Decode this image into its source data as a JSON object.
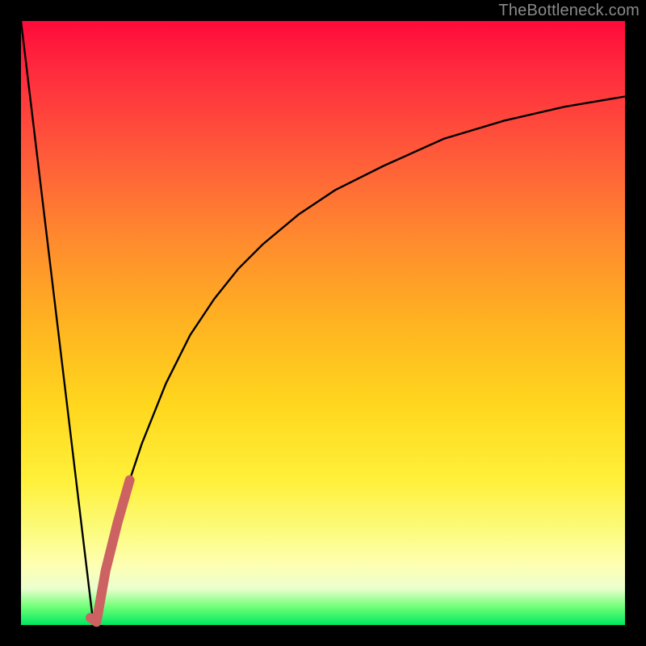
{
  "watermark": {
    "text": "TheBottleneck.com"
  },
  "colors": {
    "background": "#000000",
    "curve_stroke": "#000000",
    "highlight_stroke": "#cc6262"
  },
  "chart_data": {
    "type": "line",
    "title": "",
    "xlabel": "",
    "ylabel": "",
    "xlim": [
      0,
      100
    ],
    "ylim": [
      0,
      100
    ],
    "grid": false,
    "legend": false,
    "series": [
      {
        "name": "left-linear-drop",
        "x": [
          0,
          12
        ],
        "y": [
          100,
          0
        ]
      },
      {
        "name": "saturating-curve",
        "x": [
          12,
          14,
          16,
          18,
          20,
          24,
          28,
          32,
          36,
          40,
          46,
          52,
          60,
          70,
          80,
          90,
          100
        ],
        "y": [
          0,
          9,
          17,
          24,
          30,
          40,
          48,
          54,
          59,
          63,
          68,
          72,
          76,
          80.5,
          83.5,
          85.8,
          87.5
        ]
      },
      {
        "name": "highlight-j-segment",
        "x": [
          11.5,
          12.5,
          14,
          16,
          18
        ],
        "y": [
          1.2,
          0.5,
          9,
          17,
          24
        ]
      }
    ],
    "annotations": []
  }
}
